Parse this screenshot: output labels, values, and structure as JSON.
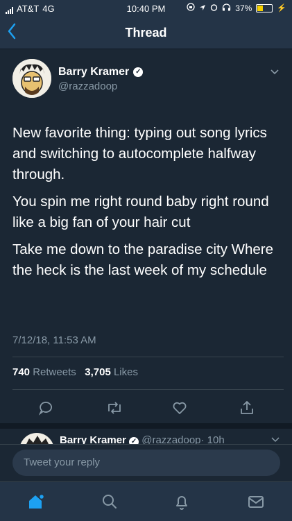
{
  "status_bar": {
    "carrier": "AT&T",
    "network": "4G",
    "time": "10:40 PM",
    "battery": "37%",
    "battery_level": 0.37,
    "battery_color": "#f5d000"
  },
  "nav": {
    "title": "Thread",
    "back_icon": "chevron-left-icon"
  },
  "tweet": {
    "author_name": "Barry Kramer",
    "author_handle": "@razzadoop",
    "paragraphs": [
      "New favorite thing: typing out song lyrics and switching to autocomplete halfway through.",
      "You spin me right round baby right round like a big fan of your hair cut",
      "Take me down to the paradise city Where the heck is the last week of my schedule"
    ],
    "timestamp": "7/12/18, 11:53 AM",
    "retweets_count": "740",
    "retweets_label": "Retweets",
    "likes_count": "3,705",
    "likes_label": "Likes"
  },
  "next_tweet": {
    "author_name": "Barry Kramer",
    "author_handle": "@razzadoop",
    "age": "· 10h"
  },
  "reply": {
    "placeholder": "Tweet your reply"
  },
  "tabs": [
    "home-icon",
    "search-icon",
    "notifications-icon",
    "messages-icon"
  ],
  "colors": {
    "background": "#1b2734",
    "bar": "#243447",
    "accent": "#1da1f2",
    "muted": "#8899a6"
  }
}
